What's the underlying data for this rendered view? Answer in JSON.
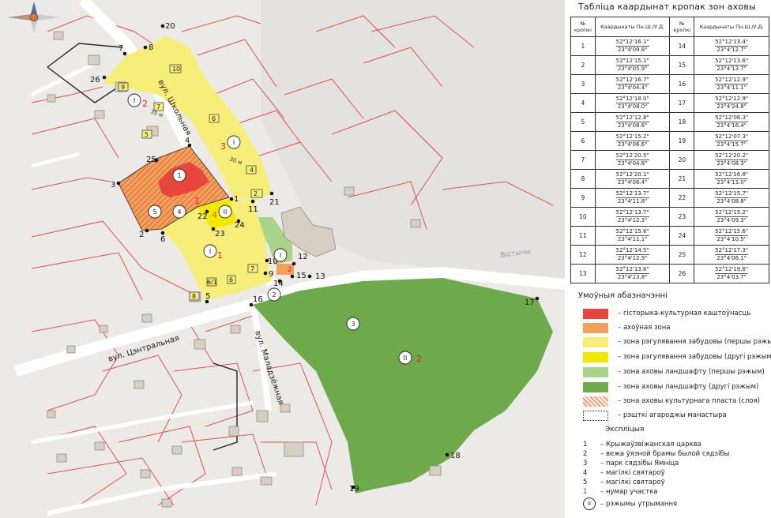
{
  "table": {
    "title": "Табліца каардынат кропак зон аховы",
    "header": {
      "num": "№ кропкі",
      "coords": "Каардынаты Пн.Ш./У.Д."
    },
    "rows": [
      {
        "n1": "1",
        "c1a": "52°12'16.1\"",
        "c1b": "23°4'09.8\"",
        "n2": "14",
        "c2a": "52°12'13.4\"",
        "c2b": "23°4'12.7\""
      },
      {
        "n1": "2",
        "c1a": "52°12'15.1\"",
        "c1b": "23°4'05.9\"",
        "n2": "15",
        "c2a": "52°12'13.6\"",
        "c2b": "23°4'13.7\""
      },
      {
        "n1": "3",
        "c1a": "52°12'16.7\"",
        "c1b": "23°4'04.4\"",
        "n2": "16",
        "c2a": "52°12'12.9\"",
        "c2b": "23°4'11.1\""
      },
      {
        "n1": "4",
        "c1a": "52°12'18.0\"",
        "c1b": "23°4'08.0\"",
        "n2": "17",
        "c2a": "52°12'12.9\"",
        "c2b": "23°4'24.8\""
      },
      {
        "n1": "5",
        "c1a": "52°12'12.8\"",
        "c1b": "23°4'08.6\"",
        "n2": "18",
        "c2a": "52°12'06.3\"",
        "c2b": "23°4'16.4\""
      },
      {
        "n1": "6",
        "c1a": "52°12'15.2\"",
        "c1b": "23°4'06.6\"",
        "n2": "19",
        "c2a": "52°12'07.3\"",
        "c2b": "23°4'15.7\""
      },
      {
        "n1": "7",
        "c1a": "52°12'20.5\"",
        "c1b": "23°4'04.8\"",
        "n2": "20",
        "c2a": "52°12'20.2\"",
        "c2b": "23°4'08.3\""
      },
      {
        "n1": "8",
        "c1a": "52°12'20.1\"",
        "c1b": "23°4'06.4\"",
        "n2": "21",
        "c2a": "52°12'16.8\"",
        "c2b": "23°4'13.0\""
      },
      {
        "n1": "9",
        "c1a": "52°12'13.7\"",
        "c1b": "23°4'11.8\"",
        "n2": "22",
        "c2a": "52°12'15.7\"",
        "c2b": "23°4'08.8\""
      },
      {
        "n1": "10",
        "c1a": "52°12'13.7\"",
        "c1b": "23°4'12.3\"",
        "n2": "23",
        "c2a": "52°12'15.2\"",
        "c2b": "23°4'09.3\""
      },
      {
        "n1": "11",
        "c1a": "52°12'15.6\"",
        "c1b": "23°4'11.1\"",
        "n2": "24",
        "c2a": "52°12'15.6\"",
        "c2b": "23°4'10.5\""
      },
      {
        "n1": "12",
        "c1a": "52°12'14.5\"",
        "c1b": "23°4'12.9\"",
        "n2": "25",
        "c2a": "52°12'17.3\"",
        "c2b": "23°4'06.1\""
      },
      {
        "n1": "13",
        "c1a": "52°12'13.6\"",
        "c1b": "23°4'13.8\"",
        "n2": "26",
        "c2a": "52°12'19.6\"",
        "c2b": "23°4'03.7\""
      }
    ]
  },
  "legend": {
    "title": "Умоўныя абазначэнні",
    "items": [
      {
        "label": "– гісторыка-культурная каштоўнасць",
        "color": "#e8453c"
      },
      {
        "label": "– ахоўная зона",
        "color": "#f2a15a"
      },
      {
        "label": "– зона рэгулявання забудовы (першы рэжым)",
        "color": "#f7ee7a"
      },
      {
        "label": "– зона рэгулявання забудовы (другі рэжым)",
        "color": "#f0e800"
      },
      {
        "label": "– зона аховы ландшафту (першы рэжым)",
        "color": "#a9d38a"
      },
      {
        "label": "– зона аховы ландшафту (другі рэжым)",
        "color": "#6ea94c"
      },
      {
        "label": "– зона аховы культурнага пласта (слоя)",
        "color": "#f4c8ae"
      },
      {
        "label": "– рэшткі агароджы манастыра",
        "color": "#ffffff"
      }
    ]
  },
  "explication": {
    "title": "Экспліцыя",
    "items": [
      {
        "key": "1",
        "label": "– Крыжаўзвіжанская царква"
      },
      {
        "key": "2",
        "label": "– вежа ўязной брамы былой сядзібы"
      },
      {
        "key": "3",
        "label": "– парк сядзібы Ямніца"
      },
      {
        "key": "4",
        "label": "– магілкі святароў"
      },
      {
        "key": "5",
        "label": "– магілкі святароў"
      },
      {
        "key": "1",
        "label": "– нумар участка"
      },
      {
        "key": "II",
        "label": "– рэжымы утрымання"
      }
    ]
  },
  "map": {
    "streets": {
      "shkolnaya": "вул. Школьная",
      "centralnaya": "вул. Цэнтральная",
      "maladzezhnaya": "вул. Маладзёжная",
      "vistychi": "Вістычы"
    },
    "measure_35": "35 м",
    "measure_30": "30 м",
    "compass": "compass-rose-icon",
    "points": [
      "1",
      "2",
      "3",
      "4",
      "5",
      "6",
      "7",
      "8",
      "9",
      "10",
      "11",
      "12",
      "13",
      "14",
      "15",
      "16",
      "17",
      "18",
      "19",
      "20",
      "21",
      "22",
      "23",
      "24",
      "25",
      "26"
    ],
    "plot_labels": [
      "1",
      "2",
      "3",
      "4",
      "1",
      "2",
      "1",
      "2"
    ],
    "regime_labels": [
      "I",
      "II",
      "III"
    ]
  }
}
